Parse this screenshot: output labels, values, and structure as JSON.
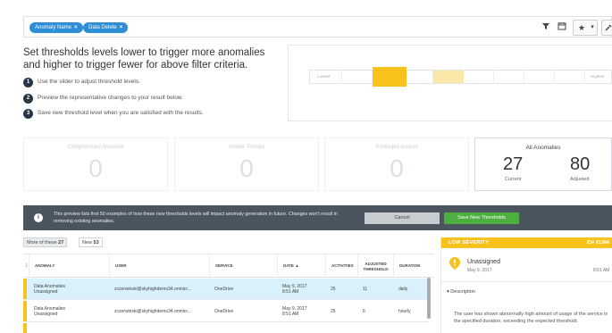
{
  "filters": [
    {
      "label": "Anomaly Name"
    },
    {
      "label": "Data Delete"
    }
  ],
  "toolbar": {
    "star": "★",
    "menu": "▾"
  },
  "heading": "Set thresholds levels lower to trigger more anomalies and higher to trigger fewer for above filter criteria.",
  "steps": [
    {
      "num": "1",
      "text": "Use the slider to adjust threshold levels."
    },
    {
      "num": "2",
      "text": "Preview the representative changes to your result below."
    },
    {
      "num": "3",
      "text": "Save new threshold level when you are satisfied with the results."
    }
  ],
  "slider": {
    "low_label": "Lowest",
    "high_label": "Highest",
    "position_fraction": 0.21
  },
  "cards": [
    {
      "title": "Compromised Accounts",
      "value": "0"
    },
    {
      "title": "Insider Threats",
      "value": "0"
    },
    {
      "title": "Privileged Access",
      "value": "0"
    }
  ],
  "all_anomalies": {
    "title": "All Anomalies",
    "current": "27",
    "current_label": "Current",
    "adjusted": "80",
    "adjusted_label": "Adjusted"
  },
  "banner": {
    "message": "This preview lists first 50 examples of how these new thresholds levels will impact anomaly generation in future. Changes won't result in removing existing anomalies.",
    "cancel": "Cancel",
    "save": "Save New Thresholds"
  },
  "tabs": [
    {
      "label": "More of these",
      "count": "27"
    },
    {
      "label": "New",
      "count": "53"
    }
  ],
  "table": {
    "columns": [
      "ANOMALY",
      "USER",
      "SERVICE",
      "DATE",
      "ACTIVITIES",
      "ADJUSTED THRESHOLD",
      "DURATION"
    ],
    "columns_split": {
      "adj1": "ADJUSTED",
      "adj2": "THRESHOLD"
    },
    "sort_icon": "▲",
    "rows": [
      {
        "anomaly": "Data Anomalies",
        "status": "Unassigned",
        "user": "zczerwinski@skyhighdemo34.onmicr...",
        "service": "OneDrive",
        "date": "May 9, 2017",
        "time": "8:51 AM",
        "activities": "25",
        "threshold": "11",
        "duration": "daily"
      },
      {
        "anomaly": "Data Anomalies",
        "status": "Unassigned",
        "user": "zczerwinski@skyhighdemo34.onmicr...",
        "service": "OneDrive",
        "date": "May 9, 2017",
        "time": "8:51 AM",
        "activities": "25",
        "threshold": "6",
        "duration": "hourly"
      }
    ]
  },
  "detail": {
    "severity": "LOW SEVERITY",
    "id": "ID# 41984",
    "title": "Unassigned",
    "date": "May 9, 2017",
    "time": "8:51 AM",
    "description_label": "Description",
    "description": "The user has shown abnormally high amount of usage of the service in the specified duration, exceeding the expected threshold."
  },
  "colors": {
    "accent": "#2f8fd6",
    "warning": "#f9c21a",
    "success": "#4caf3f",
    "banner": "#4a5560"
  }
}
